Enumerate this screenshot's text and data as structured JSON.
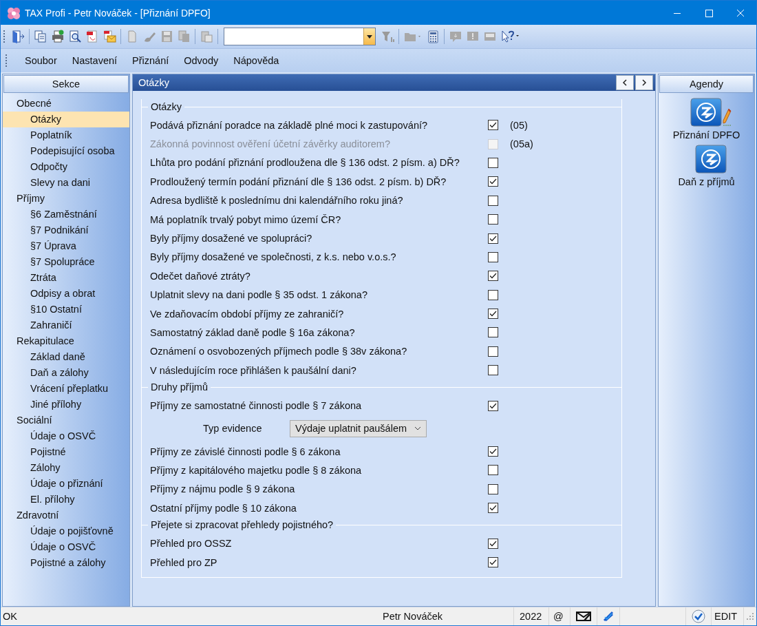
{
  "window": {
    "title": "TAX Profi - Petr Nováček - [Přiznání DPFO]"
  },
  "menu": [
    "Soubor",
    "Nastavení",
    "Přiznání",
    "Odvody",
    "Nápověda"
  ],
  "sidebar": {
    "title": "Sekce",
    "groups": [
      {
        "label": "Obecné",
        "children": [
          {
            "label": "Otázky",
            "selected": true
          },
          {
            "label": "Poplatník",
            "selected": false
          },
          {
            "label": "Podepisující osoba",
            "selected": false
          },
          {
            "label": "Odpočty",
            "selected": false
          },
          {
            "label": "Slevy na dani",
            "selected": false
          }
        ]
      },
      {
        "label": "Příjmy",
        "children": [
          {
            "label": "§6 Zaměstnání",
            "selected": false
          },
          {
            "label": "§7 Podnikání",
            "selected": false
          },
          {
            "label": "§7 Úprava",
            "selected": false
          },
          {
            "label": "§7 Spolupráce",
            "selected": false
          },
          {
            "label": "Ztráta",
            "selected": false
          },
          {
            "label": "Odpisy a obrat",
            "selected": false
          },
          {
            "label": "§10 Ostatní",
            "selected": false
          },
          {
            "label": "Zahraničí",
            "selected": false
          }
        ]
      },
      {
        "label": "Rekapitulace",
        "children": [
          {
            "label": "Základ daně",
            "selected": false
          },
          {
            "label": "Daň a zálohy",
            "selected": false
          },
          {
            "label": "Vrácení přeplatku",
            "selected": false
          },
          {
            "label": "Jiné přílohy",
            "selected": false
          }
        ]
      },
      {
        "label": "Sociální",
        "children": [
          {
            "label": "Údaje o OSVČ",
            "selected": false
          },
          {
            "label": "Pojistné",
            "selected": false
          },
          {
            "label": "Zálohy",
            "selected": false
          },
          {
            "label": "Údaje o přiznání",
            "selected": false
          },
          {
            "label": "El. přílohy",
            "selected": false
          }
        ]
      },
      {
        "label": "Zdravotní",
        "children": [
          {
            "label": "Údaje o pojišťovně",
            "selected": false
          },
          {
            "label": "Údaje o OSVČ",
            "selected": false
          },
          {
            "label": "Pojistné a zálohy",
            "selected": false
          }
        ]
      }
    ]
  },
  "panel": {
    "title": "Otázky",
    "sections": [
      {
        "title": "Otázky",
        "rows": [
          {
            "kind": "checkbox",
            "label": "Podává přiznání poradce na základě plné moci k zastupování?",
            "checked": true,
            "disabled": false,
            "code": "(05)"
          },
          {
            "kind": "checkbox",
            "label": "Zákonná povinnost ověření účetní závěrky auditorem?",
            "checked": false,
            "disabled": true,
            "code": "(05a)"
          },
          {
            "kind": "checkbox",
            "label": "Lhůta pro podání přiznání prodloužena dle § 136 odst. 2 písm. a) DŘ?",
            "checked": false,
            "disabled": false
          },
          {
            "kind": "checkbox",
            "label": "Prodloužený termín podání přiznání dle § 136 odst. 2 písm. b) DŘ?",
            "checked": true,
            "disabled": false
          },
          {
            "kind": "checkbox",
            "label": "Adresa bydliště k poslednímu dni kalendářního roku jiná?",
            "checked": false,
            "disabled": false
          },
          {
            "kind": "checkbox",
            "label": "Má poplatník trvalý pobyt mimo území ČR?",
            "checked": false,
            "disabled": false
          },
          {
            "kind": "checkbox",
            "label": "Byly příjmy dosažené ve spolupráci?",
            "checked": true,
            "disabled": false
          },
          {
            "kind": "checkbox",
            "label": "Byly příjmy dosažené ve společnosti, z k.s. nebo v.o.s.?",
            "checked": false,
            "disabled": false
          },
          {
            "kind": "checkbox",
            "label": "Odečet daňové ztráty?",
            "checked": true,
            "disabled": false
          },
          {
            "kind": "checkbox",
            "label": "Uplatnit slevy na dani podle § 35 odst. 1 zákona?",
            "checked": false,
            "disabled": false
          },
          {
            "kind": "checkbox",
            "label": "Ve zdaňovacím období příjmy ze zahraničí?",
            "checked": true,
            "disabled": false
          },
          {
            "kind": "checkbox",
            "label": "Samostatný základ daně podle § 16a zákona?",
            "checked": false,
            "disabled": false
          },
          {
            "kind": "checkbox",
            "label": "Oznámení o osvobozených příjmech podle § 38v zákona?",
            "checked": false,
            "disabled": false
          },
          {
            "kind": "checkbox",
            "label": "V následujícím roce přihlášen k paušální dani?",
            "checked": false,
            "disabled": false
          }
        ]
      },
      {
        "title": "Druhy příjmů",
        "rows": [
          {
            "kind": "checkbox",
            "label": "Příjmy ze samostatné činnosti podle § 7 zákona",
            "checked": true,
            "disabled": false
          },
          {
            "kind": "select",
            "label": "Typ evidence",
            "value": "Výdaje uplatnit paušálem"
          },
          {
            "kind": "checkbox",
            "label": "Příjmy ze závislé činnosti podle § 6 zákona",
            "checked": true,
            "disabled": false
          },
          {
            "kind": "checkbox",
            "label": "Příjmy z kapitálového majetku podle § 8 zákona",
            "checked": false,
            "disabled": false
          },
          {
            "kind": "checkbox",
            "label": "Příjmy z nájmu podle § 9 zákona",
            "checked": false,
            "disabled": false
          },
          {
            "kind": "checkbox",
            "label": "Ostatní příjmy podle § 10 zákona",
            "checked": true,
            "disabled": false
          }
        ]
      },
      {
        "title": "Přejete si zpracovat přehledy pojistného?",
        "rows": [
          {
            "kind": "checkbox",
            "label": "Přehled pro OSSZ",
            "checked": true,
            "disabled": false
          },
          {
            "kind": "checkbox",
            "label": "Přehled pro ZP",
            "checked": true,
            "disabled": false
          }
        ]
      }
    ]
  },
  "agendas": {
    "title": "Agendy",
    "items": [
      {
        "label": "Přiznání DPFO",
        "open": true
      },
      {
        "label": "Daň z příjmů",
        "open": false
      }
    ]
  },
  "status_bar": {
    "message": "OK",
    "user": "Petr Nováček",
    "year": "2022",
    "email": "@",
    "mode": "EDIT"
  }
}
